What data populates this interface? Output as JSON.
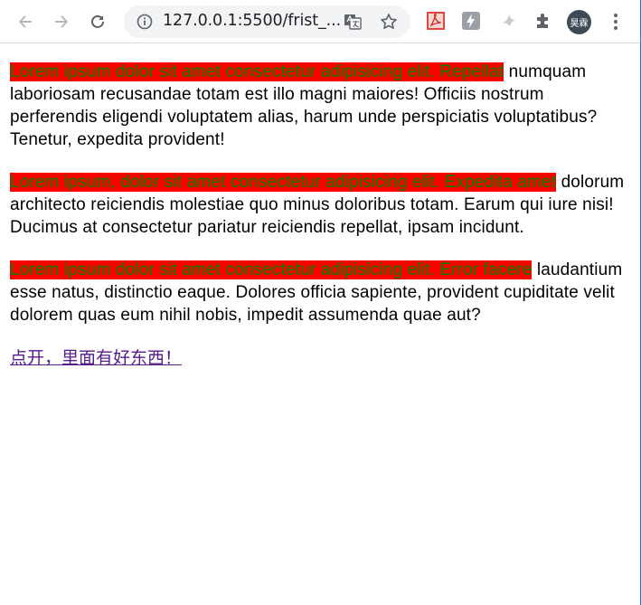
{
  "browser": {
    "url": "127.0.0.1:5500/frist_...",
    "avatar_text": "昊霖",
    "icons": [
      "back-arrow-icon",
      "forward-arrow-icon",
      "reload-icon",
      "info-icon",
      "translate-icon",
      "star-icon",
      "pdf-extension-icon",
      "lightning-extension-icon",
      "bird-extension-icon",
      "puzzle-extensions-icon",
      "more-vert-icon"
    ]
  },
  "page": {
    "paragraphs": [
      {
        "highlight": "Lorem ipsum dolor sit amet consectetur adipisicing elit. Repellat",
        "rest": " numquam laboriosam recusandae totam est illo magni maiores! Officiis nostrum perferendis eligendi voluptatem alias, harum unde perspiciatis voluptatibus? Tenetur, expedita provident!"
      },
      {
        "highlight": "Lorem ipsum, dolor sit amet consectetur adipisicing elit. Expedita amet",
        "rest": " dolorum architecto reiciendis molestiae quo minus doloribus totam. Earum qui iure nisi! Ducimus at consectetur pariatur reiciendis repellat, ipsam incidunt."
      },
      {
        "highlight": "Lorem ipsum dolor sit amet consectetur adipisicing elit. Error facere",
        "rest": " laudantium esse natus, distinctio eaque. Dolores officia sapiente, provident cupiditate velit dolorem quas eum nihil nobis, impedit assumenda quae aut?"
      }
    ],
    "link_text": "点开，里面有好东西！"
  },
  "colors": {
    "highlight_bg": "#ff0000",
    "highlight_text": "#008000",
    "link": "#551a8b"
  }
}
